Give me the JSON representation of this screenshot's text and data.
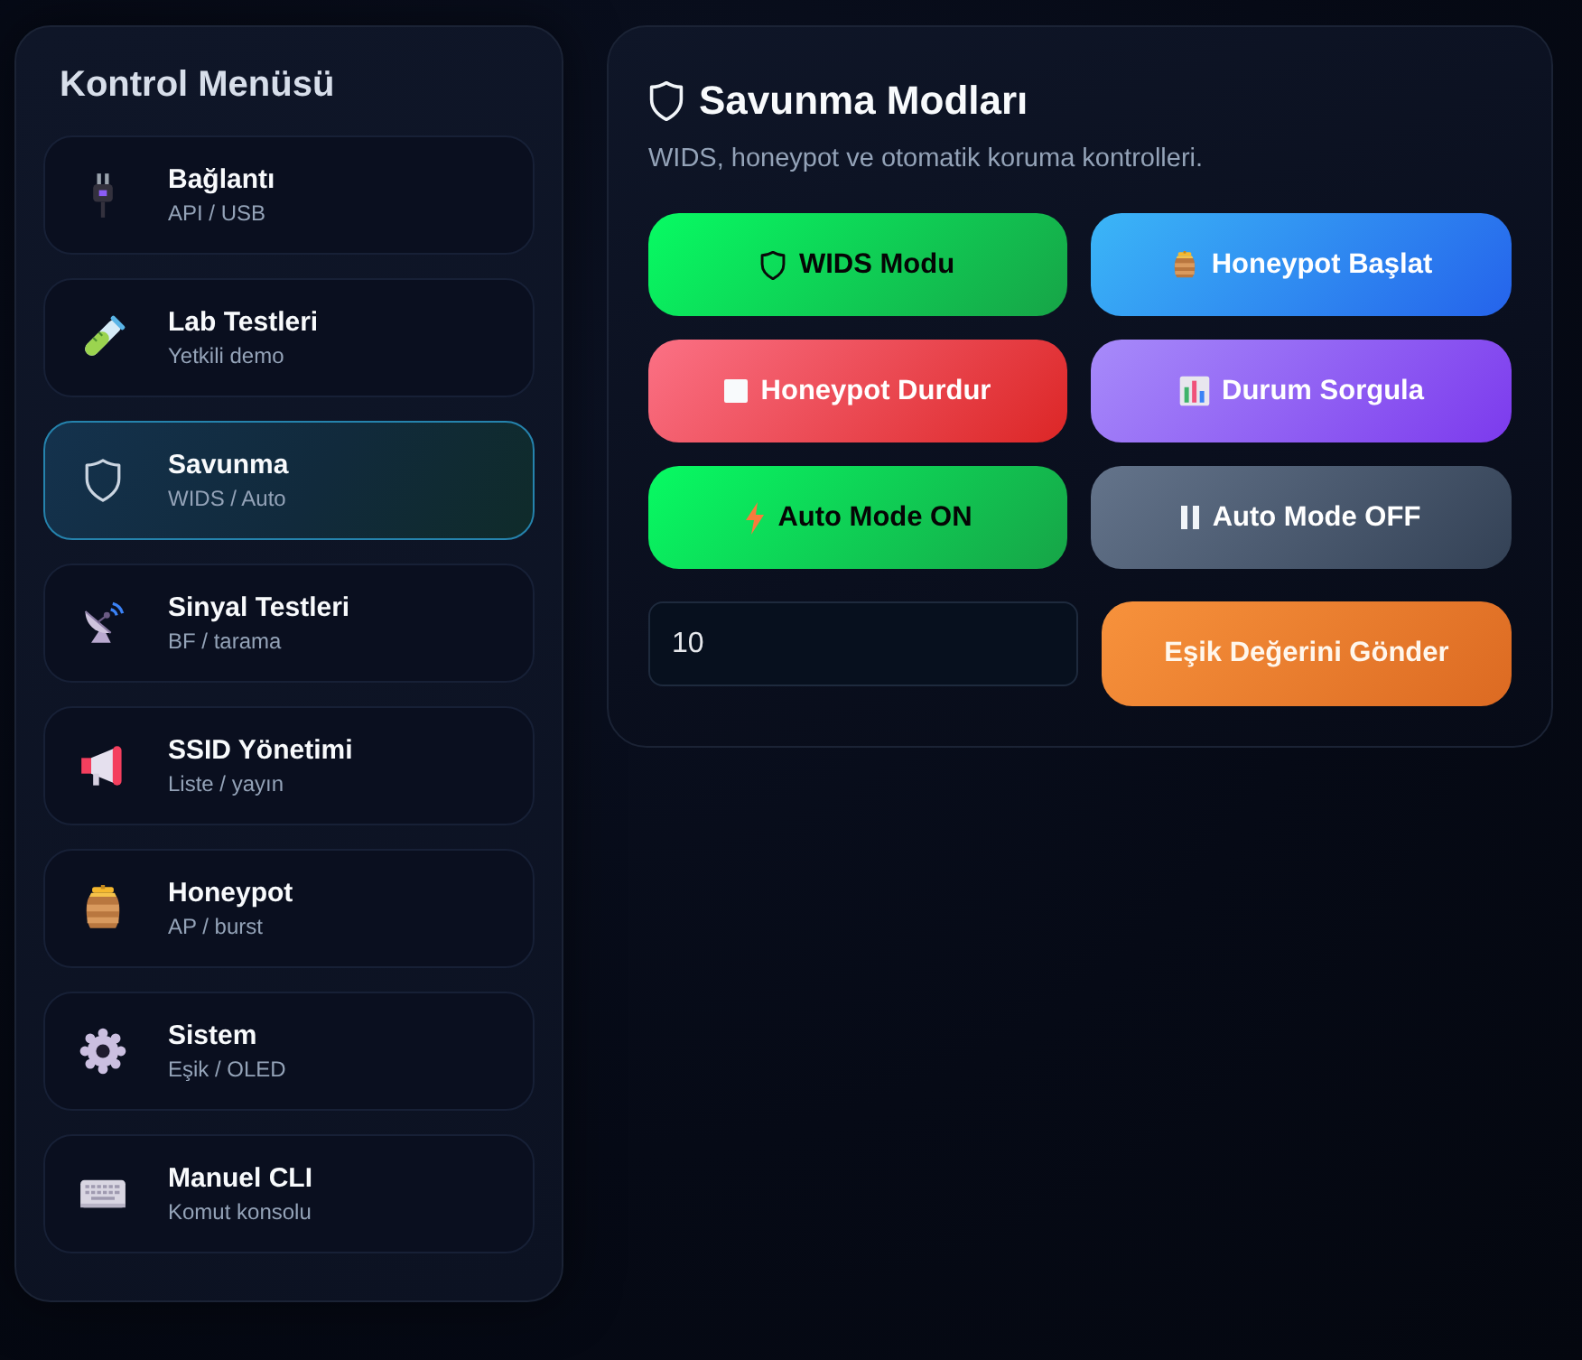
{
  "sidebar": {
    "title": "Kontrol Menüsü",
    "items": [
      {
        "label": "Bağlantı",
        "sublabel": "API / USB",
        "selected": false
      },
      {
        "label": "Lab Testleri",
        "sublabel": "Yetkili demo",
        "selected": false
      },
      {
        "label": "Savunma",
        "sublabel": "WIDS / Auto",
        "selected": true
      },
      {
        "label": "Sinyal Testleri",
        "sublabel": "BF / tarama",
        "selected": false
      },
      {
        "label": "SSID Yönetimi",
        "sublabel": "Liste / yayın",
        "selected": false
      },
      {
        "label": "Honeypot",
        "sublabel": "AP / burst",
        "selected": false
      },
      {
        "label": "Sistem",
        "sublabel": "Eşik / OLED",
        "selected": false
      },
      {
        "label": "Manuel CLI",
        "sublabel": "Komut konsolu",
        "selected": false
      }
    ]
  },
  "panel": {
    "title": "Savunma Modları",
    "subtitle": "WIDS, honeypot ve otomatik koruma kontrolleri.",
    "buttons": [
      "WIDS Modu",
      "Honeypot Başlat",
      "Honeypot Durdur",
      "Durum Sorgula",
      "Auto Mode ON",
      "Auto Mode OFF"
    ],
    "threshold": {
      "value": "10"
    },
    "submit_button": "Eşik Değerini Gönder"
  }
}
